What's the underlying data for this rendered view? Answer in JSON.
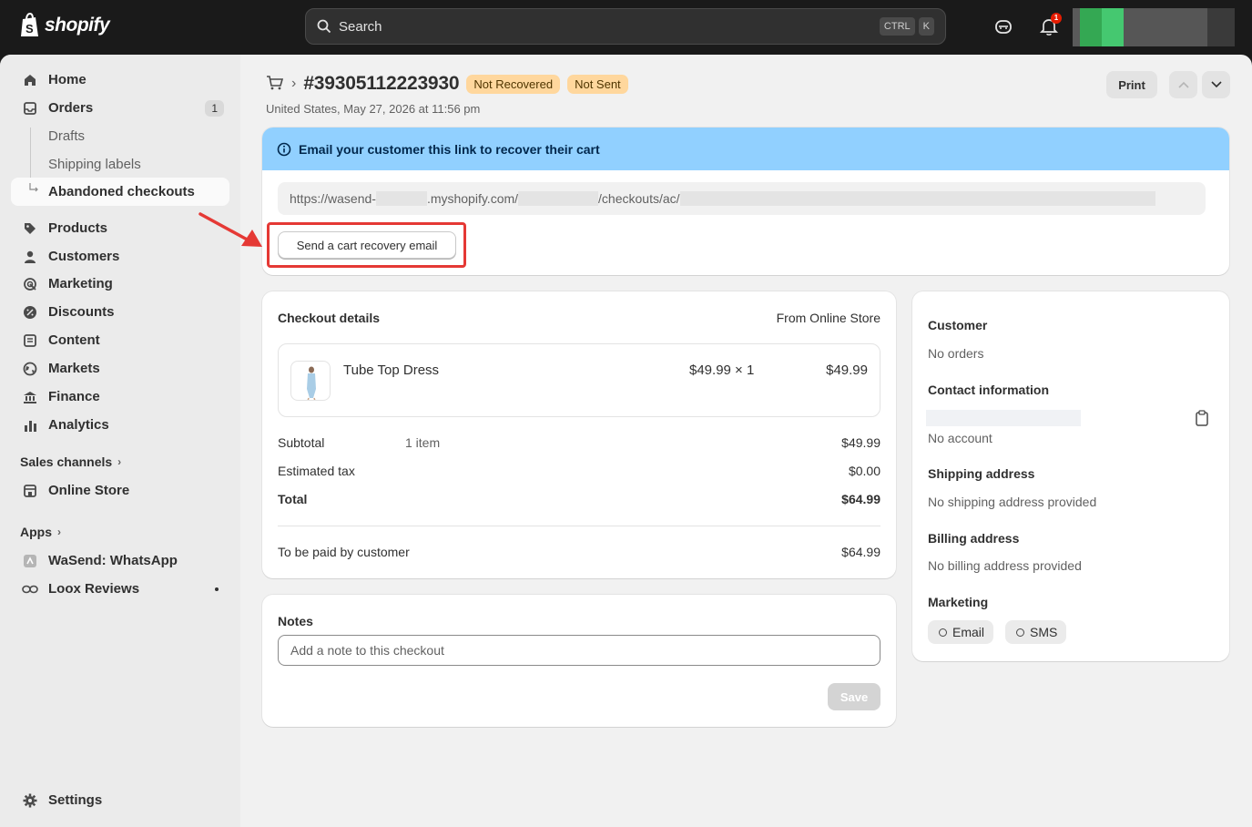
{
  "topbar": {
    "logo_text": "shopify",
    "search_placeholder": "Search",
    "kbd_ctrl": "CTRL",
    "kbd_k": "K",
    "notification_count": "1"
  },
  "sidebar": {
    "home": "Home",
    "orders": "Orders",
    "orders_count": "1",
    "drafts": "Drafts",
    "shipping_labels": "Shipping labels",
    "abandoned_checkouts": "Abandoned checkouts",
    "products": "Products",
    "customers": "Customers",
    "marketing": "Marketing",
    "discounts": "Discounts",
    "content": "Content",
    "markets": "Markets",
    "finance": "Finance",
    "analytics": "Analytics",
    "sales_channels": "Sales channels",
    "online_store": "Online Store",
    "apps": "Apps",
    "wasend": "WaSend: WhatsApp",
    "loox": "Loox Reviews",
    "settings": "Settings"
  },
  "header": {
    "title": "#39305112223930",
    "badge_recovered": "Not Recovered",
    "badge_sent": "Not Sent",
    "subtitle": "United States, May 27, 2026 at 11:56 pm",
    "print_label": "Print"
  },
  "recovery": {
    "banner_text": "Email your customer this link to recover their cart",
    "url_part1": "https://wasend-",
    "url_part2": ".myshopify.com/",
    "url_part3": "/checkouts/ac/",
    "send_button": "Send a cart recovery email"
  },
  "checkout": {
    "title": "Checkout details",
    "source": "From Online Store",
    "item_name": "Tube Top Dress",
    "item_price_qty": "$49.99 × 1",
    "item_total": "$49.99",
    "subtotal_label": "Subtotal",
    "subtotal_items": "1 item",
    "subtotal_value": "$49.99",
    "tax_label": "Estimated tax",
    "tax_value": "$0.00",
    "total_label": "Total",
    "total_value": "$64.99",
    "paid_label": "To be paid by customer",
    "paid_value": "$64.99"
  },
  "notes": {
    "title": "Notes",
    "placeholder": "Add a note to this checkout",
    "save": "Save"
  },
  "customer": {
    "title": "Customer",
    "orders": "No orders",
    "contact_title": "Contact information",
    "account": "No account",
    "shipping_title": "Shipping address",
    "shipping_value": "No shipping address provided",
    "billing_title": "Billing address",
    "billing_value": "No billing address provided",
    "marketing_title": "Marketing",
    "email_pill": "Email",
    "sms_pill": "SMS"
  },
  "colors": {
    "banner": "#91d0ff",
    "badge": "#ffd79d",
    "highlight": "#e53935",
    "topbar": "#1a1a1a"
  }
}
